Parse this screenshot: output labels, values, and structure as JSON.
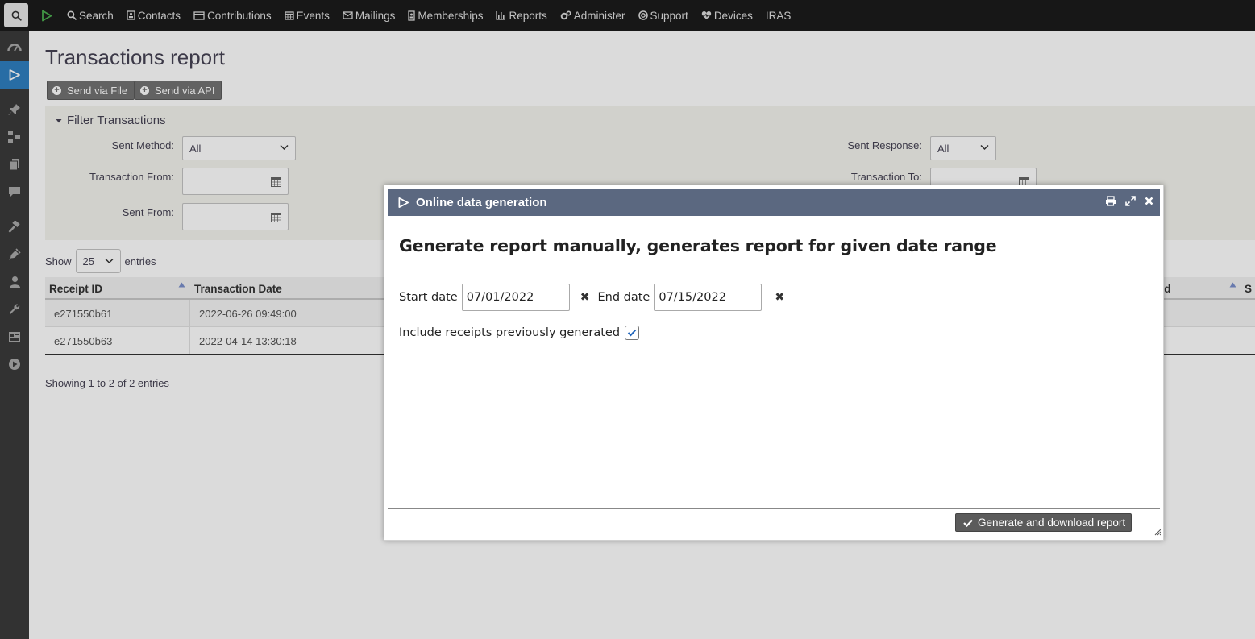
{
  "menubar": {
    "items": [
      {
        "label": "Search",
        "icon": "search-icon"
      },
      {
        "label": "Contacts",
        "icon": "contact-card-icon"
      },
      {
        "label": "Contributions",
        "icon": "credit-card-icon"
      },
      {
        "label": "Events",
        "icon": "calendar-icon"
      },
      {
        "label": "Mailings",
        "icon": "envelope-icon"
      },
      {
        "label": "Memberships",
        "icon": "id-badge-icon"
      },
      {
        "label": "Reports",
        "icon": "bar-chart-icon"
      },
      {
        "label": "Administer",
        "icon": "gears-icon"
      },
      {
        "label": "Support",
        "icon": "lifebuoy-icon"
      },
      {
        "label": "Devices",
        "icon": "heartbeat-icon"
      },
      {
        "label": "IRAS",
        "icon": ""
      }
    ]
  },
  "page": {
    "title": "Transactions report",
    "send_file_label": "Send via File",
    "send_api_label": "Send via API"
  },
  "filter": {
    "title": "Filter Transactions",
    "sent_method_label": "Sent Method:",
    "sent_method_value": "All",
    "sent_response_label": "Sent Response:",
    "sent_response_value": "All",
    "transaction_from_label": "Transaction From:",
    "transaction_to_label": "Transaction To:",
    "sent_from_label": "Sent From:"
  },
  "entries": {
    "show_label": "Show",
    "value": "25",
    "entries_label": "entries",
    "showing_text": "Showing 1 to 2 of 2 entries"
  },
  "table": {
    "columns": [
      "Receipt ID",
      "Transaction Date",
      "od",
      "S"
    ],
    "rows": [
      {
        "receipt_id": "e271550b61",
        "date": "2022-06-26 09:49:00"
      },
      {
        "receipt_id": "e271550b63",
        "date": "2022-04-14 13:30:18"
      }
    ]
  },
  "dialog": {
    "title": "Online data generation",
    "heading": "Generate report manually, generates report for given date range",
    "start_label": "Start date",
    "start_value": "07/01/2022",
    "end_label": "End date",
    "end_value": "07/15/2022",
    "clear_symbol": "✖",
    "include_label": "Include receipts previously generated",
    "include_checked": true,
    "generate_label": "Generate and download report"
  },
  "colors": {
    "menubar_bg": "#1b1b1b",
    "sidebar_bg": "#3b3b3b",
    "sidebar_active": "#2f7fc1",
    "dialog_titlebar": "#5b6880",
    "button_bg": "#737373",
    "filter_bg": "#f4f4ee",
    "brand_green": "#4caf50"
  }
}
